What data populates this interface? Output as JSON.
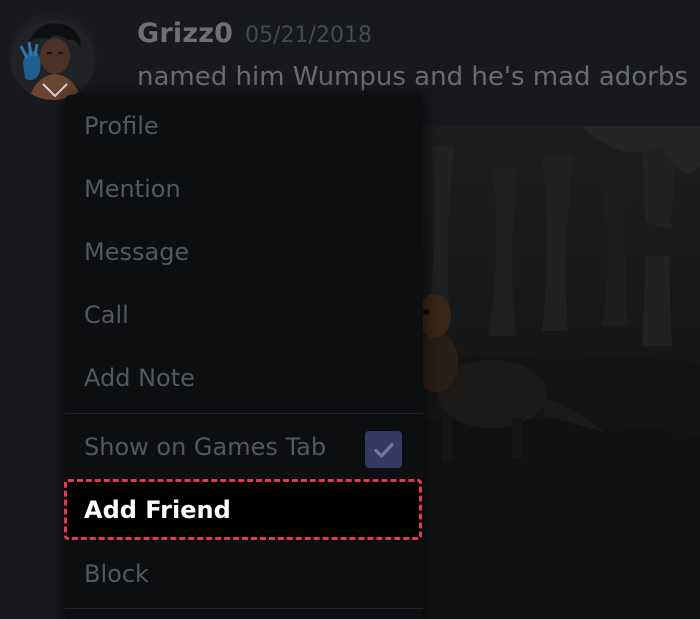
{
  "message": {
    "username": "Grizz0",
    "timestamp": "05/21/2018",
    "text": "named him Wumpus and he's mad adorbs"
  },
  "context_menu": {
    "items": [
      {
        "label": "Profile"
      },
      {
        "label": "Mention"
      },
      {
        "label": "Message"
      },
      {
        "label": "Call"
      },
      {
        "label": "Add Note"
      },
      {
        "label": "Show on Games Tab",
        "checked": true
      },
      {
        "label": "Add Friend",
        "highlighted": true
      },
      {
        "label": "Block"
      }
    ]
  },
  "colors": {
    "background": "#18191c",
    "highlight_border": "#e23a55",
    "checkbox_fill": "#343a61"
  },
  "icons": {
    "avatar": "avatar-image",
    "check": "checkmark-icon"
  }
}
